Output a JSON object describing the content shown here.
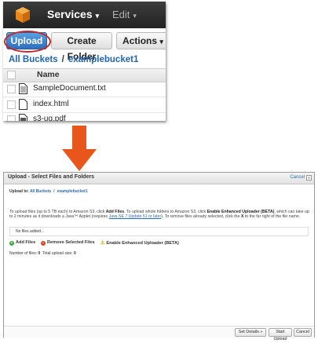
{
  "top": {
    "nav": {
      "services": "Services",
      "services_chevron": "▾",
      "edit": "Edit",
      "edit_chevron": "▾"
    },
    "toolbar": {
      "upload": "Upload",
      "create_folder": "Create Folder",
      "actions": "Actions",
      "actions_chevron": "▾"
    },
    "breadcrumb": {
      "root": "All Buckets",
      "separator": "/",
      "bucket": "examplebucket1"
    },
    "table": {
      "column_name": "Name",
      "rows": [
        {
          "name": "SampleDocument.txt"
        },
        {
          "name": "index.html"
        },
        {
          "name": "s3-ug.pdf"
        }
      ]
    }
  },
  "dialog": {
    "title": "Upload - Select Files and Folders",
    "cancel_link": "Cancel",
    "close_glyph": "x",
    "upload_to_label": "Upload to:",
    "upload_to_root": "All Buckets",
    "upload_to_separator": "/",
    "upload_to_bucket": "examplebucket1",
    "instructions": {
      "p1": "To upload files (up to 5 TB each) to Amazon S3, click ",
      "b1": "Add Files",
      "p2": ". To upload whole folders to Amazon S3, click ",
      "b2": "Enable Enhanced Uploader (BETA)",
      "p3": ", which can take up to 2 minutes as it downloads a Java™ Applet (requires ",
      "link": "Java SE 7 Update 51 or later",
      "p4": "). To remove files already selected, click the ",
      "b3": "X",
      "p5": " to the far right of the file name."
    },
    "no_files": "No files added...",
    "actions": {
      "add_files": "Add Files",
      "remove_selected": "Remove Selected Files",
      "enhanced_uploader": "Enable Enhanced Uploader (BETA)"
    },
    "counts": {
      "files_label": "Number of files:",
      "files_value": "0",
      "size_label": "Total upload size:",
      "size_value": "0"
    },
    "footer": {
      "set_details": "Set Details »",
      "start_upload": "Start Upload",
      "cancel": "Cancel"
    }
  },
  "colors": {
    "accent": "#e8561c",
    "link": "#2265b5",
    "highlight_ring": "#c62828",
    "navbar": "#2a2a2a"
  },
  "icons": [
    "aws-cube-icon",
    "chevron-down-icon",
    "file-icon",
    "down-arrow-icon",
    "add-icon",
    "remove-icon",
    "warning-icon",
    "close-icon"
  ]
}
